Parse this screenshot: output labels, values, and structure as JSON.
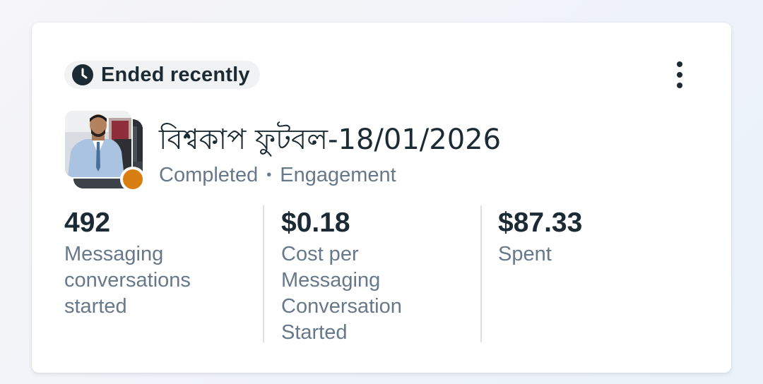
{
  "card": {
    "status_label": "Ended recently",
    "title": "বিশ্বকাপ ফুটবল-18/01/2026",
    "status": "Completed",
    "separator": "•",
    "objective": "Engagement",
    "status_dot_color": "#d97f12"
  },
  "metrics": [
    {
      "value": "492",
      "label_lines": [
        "Messaging",
        "conversations",
        "started"
      ]
    },
    {
      "value": "$0.18",
      "label_lines": [
        "Cost per",
        "Messaging",
        "Conversation",
        "Started"
      ]
    },
    {
      "value": "$87.33",
      "label_lines": [
        "Spent"
      ]
    }
  ],
  "icons": {
    "status": "clock-icon",
    "menu": "more-vertical-icon"
  }
}
